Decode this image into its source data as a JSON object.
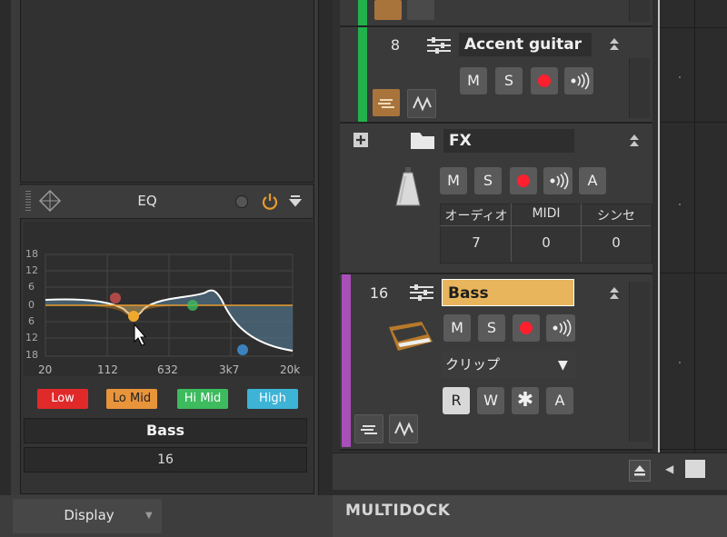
{
  "eq": {
    "title": "EQ",
    "db_ticks": [
      "18",
      "12",
      "6",
      "0",
      "6",
      "12",
      "18"
    ],
    "freq_ticks": [
      "20",
      "112",
      "632",
      "3k7",
      "20k"
    ],
    "bands": [
      {
        "label": "Low",
        "color": "#e02a2a"
      },
      {
        "label": "Lo Mid",
        "color": "#e8943a"
      },
      {
        "label": "Hi Mid",
        "color": "#3dbb5e"
      },
      {
        "label": "High",
        "color": "#3db3d6"
      }
    ]
  },
  "channel": {
    "name": "Bass",
    "number": "16"
  },
  "bottom": {
    "display_label": "Display",
    "multidock_label": "MULTIDOCK"
  },
  "tracks": [
    {
      "number": "8",
      "name": "Accent guitar",
      "color": "#22b14c",
      "buttons": [
        "M",
        "S"
      ]
    },
    {
      "name": "FX",
      "buttons": [
        "M",
        "S",
        "A"
      ],
      "table": {
        "headers": [
          "オーディオ",
          "MIDI",
          "シンセ"
        ],
        "values": [
          "7",
          "0",
          "0"
        ]
      }
    },
    {
      "number": "16",
      "name": "Bass",
      "color": "#a84fb8",
      "buttons": [
        "M",
        "S"
      ],
      "input": "クリップ",
      "bottom_buttons": [
        "R",
        "W",
        "A"
      ]
    }
  ],
  "colors": {
    "accent_orange": "#e89b2d",
    "name_highlight": "#e8b55c"
  }
}
